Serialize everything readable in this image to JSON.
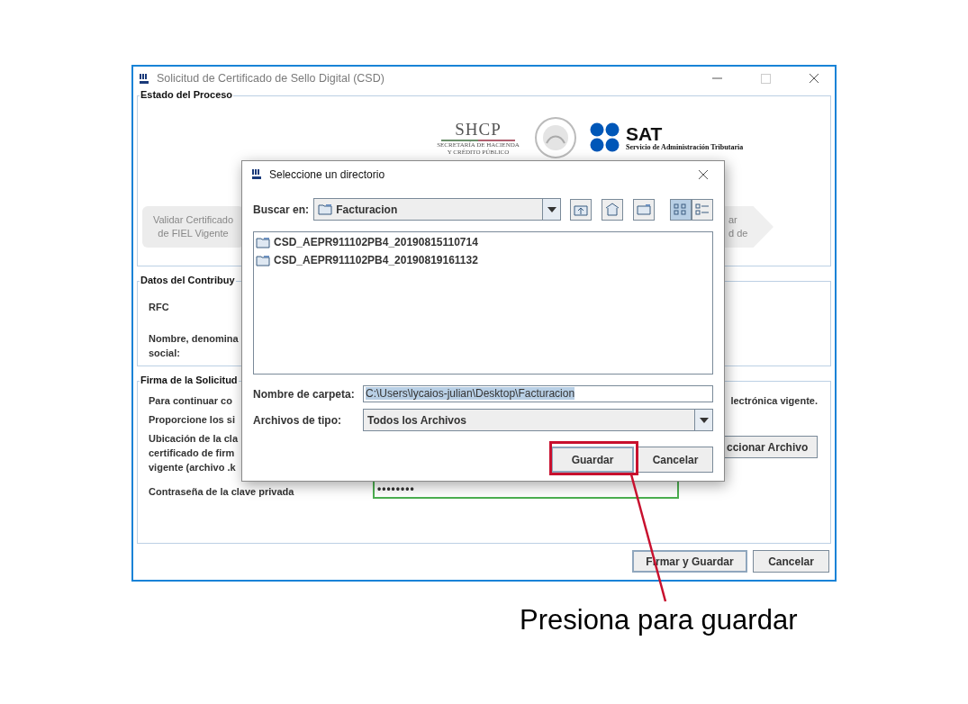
{
  "window": {
    "title": "Solicitud de Certificado de Sello Digital (CSD)",
    "controls": [
      {
        "kind": "minimize"
      },
      {
        "kind": "maximize"
      },
      {
        "kind": "close"
      }
    ]
  },
  "process_panel": {
    "title": "Estado del Proceso",
    "shcp": {
      "name": "SHCP",
      "line_1": "SECRETARÍA DE HACIENDA",
      "line_2": "Y CRÉDITO PÚBLICO"
    },
    "sat": {
      "name": "SAT",
      "subtitle": "Servicio de Administración Tributaria"
    },
    "steps": [
      {
        "lines": [
          "Validar Certificado",
          "de FIEL Vigente"
        ]
      },
      {
        "lines": [
          "ar",
          "d de"
        ]
      }
    ]
  },
  "taxpayer_panel": {
    "title": "Datos del Contribuy",
    "fields": [
      {
        "lines": [
          "RFC"
        ]
      },
      {
        "lines": [
          "Nombre, denomina",
          "social:"
        ]
      }
    ]
  },
  "signature_panel": {
    "title": "Firma de la Solicitud",
    "rows": [
      {
        "kind": "text",
        "lines": [
          "Para continuar co"
        ],
        "right": "lectrónica vigente."
      },
      {
        "kind": "text",
        "lines": [
          "Proporcione los si"
        ]
      },
      {
        "kind": "file",
        "lines": [
          "Ubicación de la cla",
          "certificado de firm",
          "vigente (archivo .k"
        ],
        "button": "ccionar Archivo"
      },
      {
        "kind": "password",
        "lines": [
          "Contraseña de la clave privada"
        ],
        "value": "••••••••"
      }
    ]
  },
  "footer_buttons": [
    {
      "label": "Firmar y Guardar",
      "default": true
    },
    {
      "label": "Cancelar",
      "default": false
    }
  ],
  "dialog": {
    "title": "Seleccione un directorio",
    "look_in": {
      "label": "Buscar en:",
      "value": "Facturacion"
    },
    "tools": [
      {
        "kind": "up",
        "selected": false
      },
      {
        "kind": "home",
        "selected": false
      },
      {
        "kind": "new-folder",
        "selected": false
      },
      {
        "kind": "list",
        "selected": true
      },
      {
        "kind": "details",
        "selected": false
      }
    ],
    "files": [
      {
        "name": "CSD_AEPR911102PB4_20190815110714"
      },
      {
        "name": "CSD_AEPR911102PB4_20190819161132"
      }
    ],
    "folder_name": {
      "label": "Nombre de carpeta:",
      "value": "C:\\Users\\lycaios-julian\\Desktop\\Facturacion",
      "text_selected": true
    },
    "file_type": {
      "label": "Archivos de tipo:",
      "value": "Todos los Archivos"
    },
    "buttons": [
      {
        "label": "Guardar",
        "default": true
      },
      {
        "label": "Cancelar",
        "default": false
      }
    ]
  },
  "annotation": {
    "text": "Presiona para guardar"
  }
}
